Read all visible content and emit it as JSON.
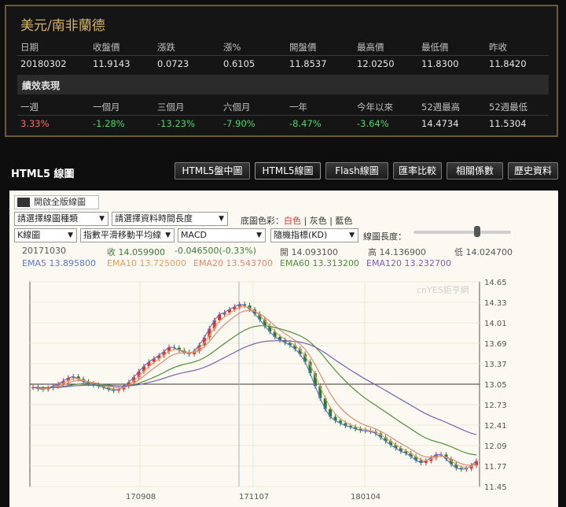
{
  "quote": {
    "title": "美元/南非蘭德",
    "headers": [
      "日期",
      "收盤價",
      "漲跌",
      "漲%",
      "開盤價",
      "最高價",
      "最低價",
      "昨收"
    ],
    "values": [
      "20180302",
      "11.9143",
      "0.0723",
      "0.6105",
      "11.8537",
      "12.0250",
      "11.8300",
      "11.8420"
    ],
    "perf_title": "績效表現",
    "perf_headers": [
      "一週",
      "一個月",
      "三個月",
      "六個月",
      "一年",
      "今年以來",
      "52週最高",
      "52週最低"
    ],
    "perf_values": [
      "3.33%",
      "-1.28%",
      "-13.23%",
      "-7.90%",
      "-8.47%",
      "-3.64%",
      "14.4734",
      "11.5304"
    ]
  },
  "chart_header": {
    "title": "HTML5 線圖",
    "tabs": [
      "HTML5盤中圖",
      "HTML5線圖",
      "Flash線圖",
      "匯率比較",
      "相關係數",
      "歷史資料"
    ]
  },
  "controls": {
    "full_link": "開啟全版線圖",
    "select_type": "請選擇線圖種類",
    "select_period": "請選擇資料時間長度",
    "bg_label": "底圖色彩：",
    "bg_white": "白色",
    "bg_gray": "灰色",
    "bg_blue": "藍色",
    "chart_kind": "K線圖",
    "ma_kind": "指數平滑移動平均線",
    "macd": "MACD",
    "kd": "隨機指標(KD)",
    "length_label": "線圖長度：",
    "slider_level": 0.65
  },
  "info": {
    "date": "20171030",
    "close": "收 14.059900",
    "change": "-0.046500(-0.33%)",
    "open": "開 14.093100",
    "high": "高 14.136900",
    "low": "低 14.024700",
    "ema5": "EMA5 13.895800",
    "ema10": "EMA10 13.725000",
    "ema20": "EMA20 13.543700",
    "ema60": "EMA60 13.313200",
    "ema120": "EMA120 13.232700",
    "watermark": "cnYES鉅亨網"
  },
  "colors": {
    "ema5": "#5b78c8",
    "ema10": "#e4a060",
    "ema20": "#e08b70",
    "ema60": "#4f8f3a",
    "ema120": "#7a60b0",
    "up": "#e03030",
    "down": "#2a7a3a"
  },
  "chart_data": {
    "type": "line",
    "y_ticks": [
      "14.65",
      "14.33",
      "14.01",
      "13.69",
      "13.37",
      "13.05",
      "12.73",
      "12.41",
      "12.09",
      "11.77",
      "11.45"
    ],
    "x_ticks": [
      "170908",
      "171107",
      "180104"
    ],
    "ylim": [
      11.45,
      14.65
    ],
    "x": [
      0,
      4,
      8,
      12,
      16,
      20,
      24,
      28,
      32,
      36,
      40,
      44,
      48,
      52,
      56,
      60,
      64,
      68,
      72,
      76,
      80,
      84,
      88,
      92,
      96,
      100,
      104,
      108,
      112,
      116,
      120,
      124,
      128,
      132,
      136,
      140,
      144,
      148,
      152,
      156,
      160,
      164,
      168,
      172,
      176,
      180,
      184,
      188,
      192,
      196,
      200,
      204,
      208,
      212,
      216,
      220,
      224,
      228,
      232,
      236,
      240,
      244,
      248,
      252,
      256,
      260,
      264,
      268,
      272,
      276,
      280,
      284,
      288,
      292,
      296,
      300,
      304,
      308,
      312,
      316,
      320,
      324,
      328,
      332,
      336,
      340,
      344,
      348,
      352,
      356,
      360,
      364,
      368,
      372,
      376,
      380,
      384,
      388,
      392,
      396,
      400,
      404,
      408,
      412,
      416,
      420,
      424,
      428,
      432,
      436,
      440,
      444,
      448,
      452,
      456,
      460,
      464,
      468,
      472,
      476,
      480,
      484,
      488,
      492,
      496,
      500,
      504,
      508,
      512,
      516,
      520,
      524,
      528,
      532,
      536,
      540,
      544,
      548,
      552,
      556,
      560,
      564,
      568
    ],
    "series": [
      {
        "name": "EMA5",
        "values": [
          13.0,
          12.98,
          12.97,
          12.99,
          13.02,
          13.05,
          13.1,
          13.15,
          13.17,
          13.13,
          13.09,
          13.06,
          13.04,
          13.02,
          13.0,
          12.97,
          12.95,
          12.97,
          13.02,
          13.08,
          13.16,
          13.25,
          13.33,
          13.4,
          13.45,
          13.5,
          13.56,
          13.63,
          13.62,
          13.58,
          13.55,
          13.52,
          13.57,
          13.66,
          13.78,
          13.92,
          14.05,
          14.14,
          14.17,
          14.22,
          14.26,
          14.3,
          14.28,
          14.22,
          14.15,
          14.06,
          13.96,
          13.87,
          13.79,
          13.74,
          13.7,
          13.66,
          13.6,
          13.52,
          13.4,
          13.22,
          13.02,
          12.83,
          12.66,
          12.54,
          12.48,
          12.44,
          12.4,
          12.38,
          12.35,
          12.33,
          12.32,
          12.31,
          12.28,
          12.22,
          12.16,
          12.1,
          12.05,
          12.0,
          11.97,
          11.92,
          11.86,
          11.82,
          11.85,
          11.9,
          11.95,
          11.95,
          11.88,
          11.8,
          11.74,
          11.72,
          11.73,
          11.78,
          11.85
        ]
      }
    ]
  }
}
